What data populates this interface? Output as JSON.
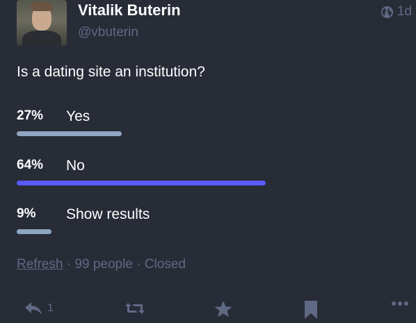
{
  "status": {
    "author": {
      "display_name": "Vitalik Buterin",
      "handle": "@vbuterin"
    },
    "visibility_icon": "globe-icon",
    "relative_time": "1d",
    "text": "Is a dating site an institution?"
  },
  "poll": {
    "options": [
      {
        "percent_label": "27%",
        "label": "Yes",
        "fraction": 0.27,
        "leading": false
      },
      {
        "percent_label": "64%",
        "label": "No",
        "fraction": 0.64,
        "leading": true
      },
      {
        "percent_label": "9%",
        "label": "Show results",
        "fraction": 0.09,
        "leading": false
      }
    ],
    "footer": {
      "refresh_label": "Refresh",
      "separator": " · ",
      "voters": "99 people",
      "state": "Closed"
    }
  },
  "actions": {
    "reply_icon": "reply-icon",
    "reply_count": "1",
    "boost_icon": "boost-icon",
    "favourite_icon": "star-icon",
    "bookmark_icon": "bookmark-icon",
    "more_icon": "ellipsis-icon"
  },
  "colors": {
    "background": "#282c37",
    "muted": "#606984",
    "bar": "#8fa6c2",
    "bar_leading": "#595aff"
  }
}
